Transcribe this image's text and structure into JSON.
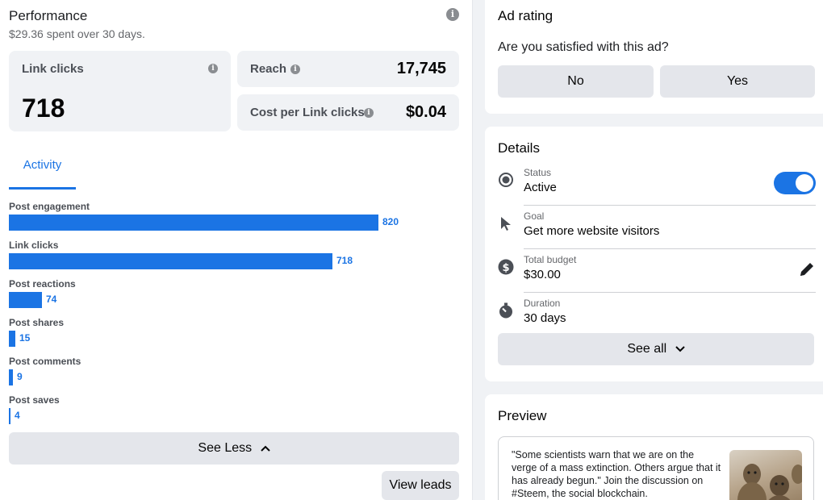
{
  "performance": {
    "title": "Performance",
    "subtitle": "$29.36 spent over 30 days.",
    "link_clicks": {
      "label": "Link clicks",
      "value": "718"
    },
    "reach": {
      "label": "Reach",
      "value": "17,745"
    },
    "cost_per": {
      "label": "Cost per Link clicks",
      "value": "$0.04"
    },
    "tab": "Activity",
    "activity": [
      {
        "label": "Post engagement",
        "value": 820,
        "display": "820"
      },
      {
        "label": "Link clicks",
        "value": 718,
        "display": "718"
      },
      {
        "label": "Post reactions",
        "value": 74,
        "display": "74"
      },
      {
        "label": "Post shares",
        "value": 15,
        "display": "15"
      },
      {
        "label": "Post comments",
        "value": 9,
        "display": "9"
      },
      {
        "label": "Post saves",
        "value": 4,
        "display": "4"
      }
    ],
    "see_less": "See Less",
    "view_leads": "View leads"
  },
  "ad_rating": {
    "title": "Ad rating",
    "question": "Are you satisfied with this ad?",
    "no": "No",
    "yes": "Yes"
  },
  "details": {
    "title": "Details",
    "items": [
      {
        "key": "Status",
        "value": "Active",
        "icon": "radio-icon"
      },
      {
        "key": "Goal",
        "value": "Get more website visitors",
        "icon": "cursor-icon"
      },
      {
        "key": "Total budget",
        "value": "$30.00",
        "icon": "dollar-icon"
      },
      {
        "key": "Duration",
        "value": "30 days",
        "icon": "stopwatch-icon"
      }
    ],
    "status_on": true,
    "see_all": "See all"
  },
  "preview": {
    "title": "Preview",
    "text": "\"Some scientists warn that we are on the verge of a mass extinction. Others argue that it has already begun.\" Join the discussion on #Steem, the social blockchain."
  },
  "colors": {
    "accent": "#1b74e4",
    "button_bg": "#e4e6eb",
    "card_bg": "#f0f2f5"
  }
}
